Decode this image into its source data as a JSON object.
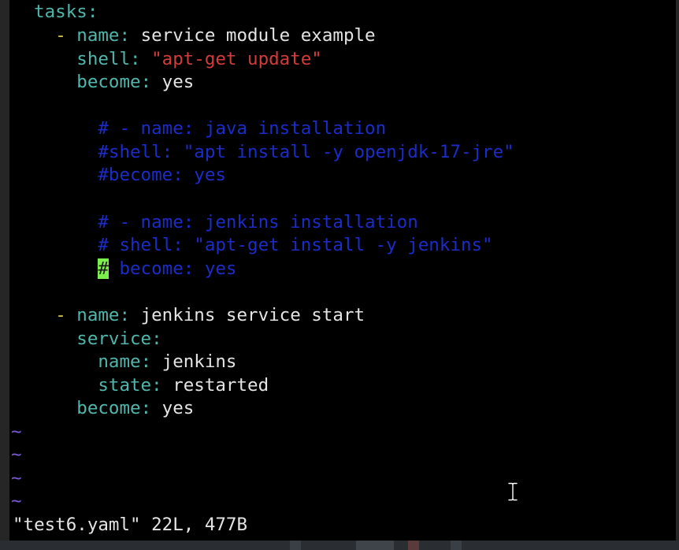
{
  "editor": {
    "lines": [
      {
        "indent": "  ",
        "key": "tasks",
        "sep": ":"
      },
      {
        "indent": "    ",
        "dash": "- ",
        "key": "name",
        "sep": ": ",
        "value": "service module example"
      },
      {
        "indent": "      ",
        "key": "shell",
        "sep": ": ",
        "string": "\"apt-get update\""
      },
      {
        "indent": "      ",
        "key": "become",
        "sep": ": ",
        "value": "yes"
      },
      {},
      {
        "indent": "        ",
        "comment": "# - name: java installation"
      },
      {
        "indent": "        ",
        "comment": "#shell: \"apt install -y openjdk-17-jre\""
      },
      {
        "indent": "        ",
        "comment": "#become: yes"
      },
      {},
      {
        "indent": "        ",
        "comment": "# - name: jenkins installation"
      },
      {
        "indent": "        ",
        "comment": "# shell: \"apt-get install -y jenkins\""
      },
      {
        "indent": "        ",
        "cursor_char": "#",
        "comment": " become: yes"
      },
      {},
      {
        "indent": "    ",
        "dash": "- ",
        "key": "name",
        "sep": ": ",
        "value": "jenkins service start"
      },
      {
        "indent": "      ",
        "key": "service",
        "sep": ":"
      },
      {
        "indent": "        ",
        "key": "name",
        "sep": ": ",
        "value": "jenkins"
      },
      {
        "indent": "        ",
        "key": "state",
        "sep": ": ",
        "value": "restarted"
      },
      {
        "indent": "      ",
        "key": "become",
        "sep": ": ",
        "value": "yes"
      }
    ],
    "tildes": [
      "~",
      "~",
      "~",
      "~"
    ],
    "status_line": "\"test6.yaml\" 22L, 477B"
  },
  "colors": {
    "background": "#000000",
    "yaml_key": "#4fb7ad",
    "yaml_dash": "#d8c34a",
    "yaml_string": "#d53b3b",
    "comment": "#1c2cc9",
    "tilde": "#7a5ad8",
    "cursor": "#7cf04a",
    "text": "#e4e4e4"
  },
  "icons": {
    "mouse_pointer": "text-ibeam-icon"
  }
}
